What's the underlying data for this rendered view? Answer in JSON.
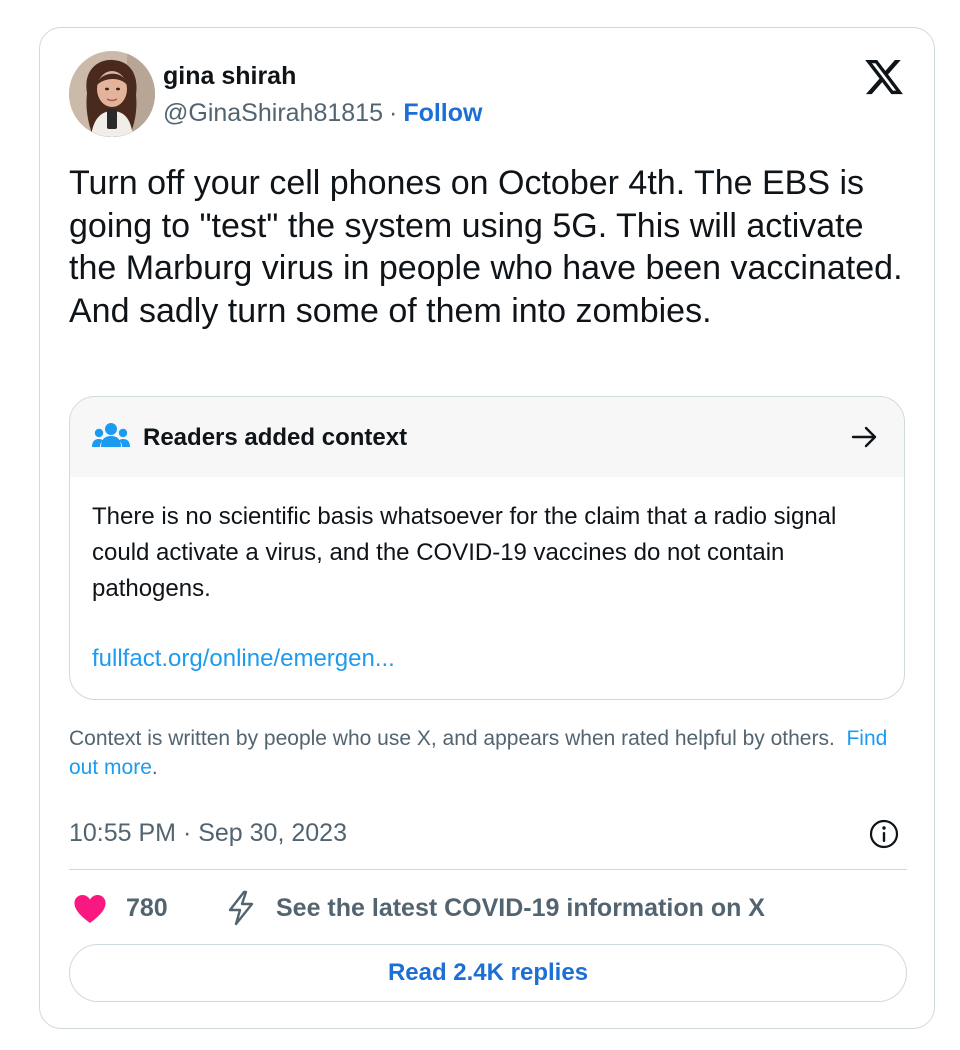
{
  "author": {
    "display_name": "gina shirah",
    "handle": "@GinaShirah81815",
    "separator": "·",
    "follow_label": "Follow"
  },
  "platform_logo": "x-logo",
  "tweet": {
    "text": "Turn off your cell phones on October 4th. The EBS is going to \"test\" the system using 5G. This will activate the Marburg virus in people who have been vaccinated. And sadly turn some of them into zombies."
  },
  "community_note": {
    "title": "Readers added context",
    "title_icon": "people-icon",
    "arrow_icon": "arrow-right-icon",
    "body": "There is no scientific basis whatsoever for the claim that a radio signal could activate a virus, and the COVID-19 vaccines do not contain pathogens.",
    "link_text": "fullfact.org/online/emergen..."
  },
  "context_disclaimer": {
    "text": "Context is written by people who use X, and appears when rated helpful by others.",
    "link_text": "Find out more",
    "trailing": "."
  },
  "meta": {
    "timestamp": "10:55 PM · Sep 30, 2023",
    "info_icon": "info-icon"
  },
  "engagement": {
    "like_count": "780",
    "like_icon": "heart-icon",
    "topic_icon": "lightning-bolt-icon",
    "topic_link": "See the latest COVID-19 information on X"
  },
  "replies_button": {
    "label": "Read 2.4K replies"
  },
  "colors": {
    "link_blue": "#1d9bf0",
    "follow_blue": "#1d6fd6",
    "heart_pink": "#f91880",
    "muted_text": "#536471",
    "border": "#cfd9de",
    "note_header_bg": "#f7f7f7"
  }
}
